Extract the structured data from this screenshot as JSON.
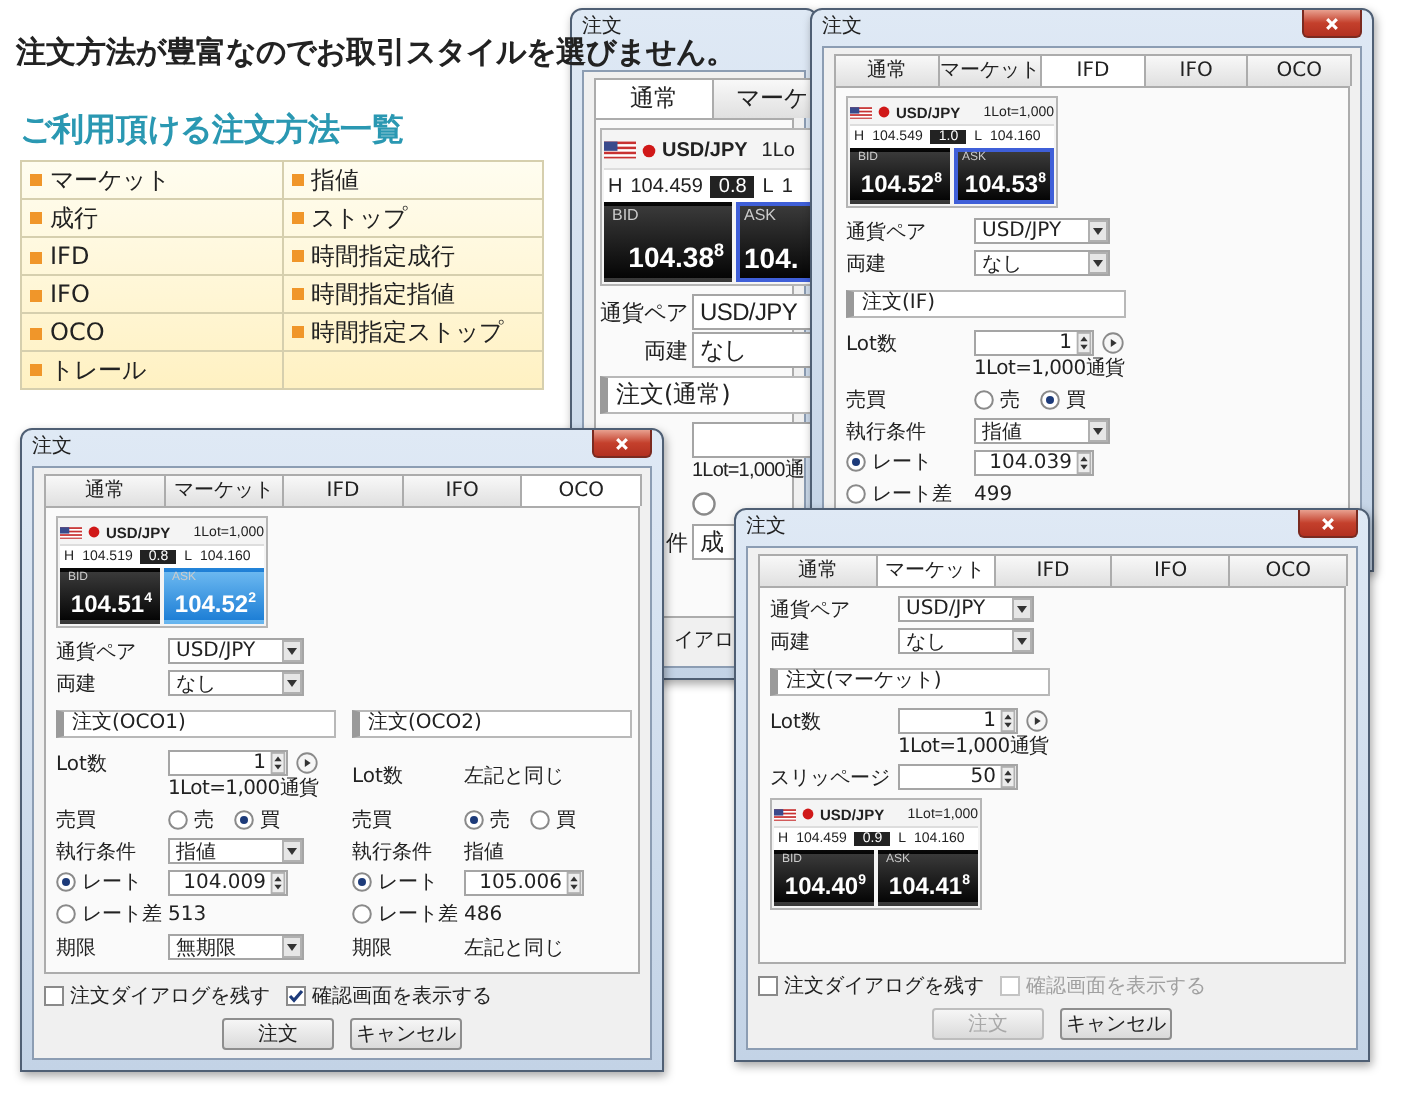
{
  "headline": "注文方法が豊富なのでお取引スタイルを選びません。",
  "subheading": "ご利用頂ける注文方法一覧",
  "order_types": [
    {
      "cells": [
        "マーケット",
        "指値"
      ]
    },
    {
      "cells": [
        "成行",
        "ストップ"
      ]
    },
    {
      "cells": [
        "IFD",
        "時間指定成行"
      ]
    },
    {
      "cells": [
        "IFO",
        "時間指定指値"
      ]
    },
    {
      "cells": [
        "OCO",
        "時間指定ストップ"
      ]
    },
    {
      "cells": [
        "トレール"
      ]
    }
  ],
  "windows": [
    {
      "kind": "zoomed",
      "title": "注文",
      "tabs": [
        {
          "label": "通常",
          "selected": true
        },
        {
          "label": "マーケ",
          "selected": false
        }
      ],
      "blocks": [
        {
          "kind": "quote",
          "pair": "USD/JPY",
          "lot_unit": "1Lo",
          "high_label": "H",
          "high": "104.459",
          "spread": "0.8",
          "low_label": "L",
          "low": "1",
          "bid_label": "BID",
          "bid": "104.38$^{8}$",
          "ask_label": "ASK",
          "ask": "104.",
          "ask_outlined": true,
          "ask_filled": false
        },
        {
          "kind": "select",
          "label": "通貨ペア",
          "value": "USD/JPY"
        },
        {
          "kind": "select",
          "label": "両建",
          "value": "なし"
        },
        {
          "kind": "header",
          "text": "注文(通常)"
        },
        {
          "kind": "spin",
          "note": "1Lot=1,000通"
        },
        {
          "kind": "radios",
          "options": [
            {
              "selected": false
            }
          ]
        },
        {
          "kind": "select",
          "label": "件",
          "value": "成"
        }
      ],
      "checks": [
        {
          "label": "イアロ"
        }
      ]
    },
    {
      "kind": "dialog",
      "title": "注文",
      "tabs": [
        {
          "label": "通常",
          "selected": false
        },
        {
          "label": "マーケット",
          "selected": false
        },
        {
          "label": "IFD",
          "selected": true
        },
        {
          "label": "IFO",
          "selected": false
        },
        {
          "label": "OCO",
          "selected": false
        }
      ],
      "blocks": [
        {
          "kind": "quote",
          "pair": "USD/JPY",
          "lot_unit": "1Lot=1,000",
          "high_label": "H",
          "high": "104.549",
          "spread": "1.0",
          "low_label": "L",
          "low": "104.160",
          "bid_label": "BID",
          "bid": "104.52$^{8}$",
          "ask_label": "ASK",
          "ask": "104.53$^{8}$",
          "ask_outlined": true,
          "ask_filled": false
        },
        {
          "kind": "select",
          "label": "通貨ペア",
          "value": "USD/JPY"
        },
        {
          "kind": "select",
          "label": "両建",
          "value": "なし"
        },
        {
          "kind": "header",
          "text": "注文(IF)"
        },
        {
          "kind": "spin",
          "label": "Lot数",
          "value": "1",
          "play": true,
          "note": "1Lot=1,000通貨"
        },
        {
          "kind": "radios",
          "label": "売買",
          "options": [
            {
              "label": "売",
              "selected": false
            },
            {
              "label": "買",
              "selected": true
            }
          ]
        },
        {
          "kind": "select",
          "label": "執行条件",
          "value": "指値"
        },
        {
          "kind": "radio_spin",
          "label": "レート",
          "selected": true,
          "value": "104.039"
        },
        {
          "kind": "radio_text",
          "label": "レート差",
          "selected": false,
          "value": "499"
        }
      ]
    },
    {
      "kind": "dialog",
      "title": "注文",
      "tabs": [
        {
          "label": "通常",
          "selected": false
        },
        {
          "label": "マーケット",
          "selected": false
        },
        {
          "label": "IFD",
          "selected": false
        },
        {
          "label": "IFO",
          "selected": false
        },
        {
          "label": "OCO",
          "selected": true
        }
      ],
      "blocks": [
        {
          "kind": "quote",
          "pair": "USD/JPY",
          "lot_unit": "1Lot=1,000",
          "high_label": "H",
          "high": "104.519",
          "spread": "0.8",
          "low_label": "L",
          "low": "104.160",
          "bid_label": "BID",
          "bid": "104.51$^{4}$",
          "ask_label": "ASK",
          "ask": "104.52$^{2}$",
          "ask_outlined": false,
          "ask_filled": true
        },
        {
          "kind": "select",
          "label": "通貨ペア",
          "value": "USD/JPY"
        },
        {
          "kind": "select",
          "label": "両建",
          "value": "なし"
        },
        {
          "kind": "columns",
          "columns": [
            [
              {
                "kind": "header",
                "text": "注文(OCO1)"
              },
              {
                "kind": "spin",
                "label": "Lot数",
                "value": "1",
                "play": true,
                "note": "1Lot=1,000通貨"
              },
              {
                "kind": "radios",
                "label": "売買",
                "options": [
                  {
                    "label": "売",
                    "selected": false
                  },
                  {
                    "label": "買",
                    "selected": true
                  }
                ]
              },
              {
                "kind": "select",
                "label": "執行条件",
                "value": "指値"
              },
              {
                "kind": "radio_spin",
                "label": "レート",
                "selected": true,
                "value": "104.009"
              },
              {
                "kind": "radio_text",
                "label": "レート差",
                "selected": false,
                "value": "513"
              },
              {
                "kind": "select",
                "label": "期限",
                "value": "無期限"
              }
            ],
            [
              {
                "kind": "header",
                "text": "注文(OCO2)"
              },
              {
                "kind": "text",
                "label": "Lot数",
                "value": "左記と同じ"
              },
              {
                "kind": "radios",
                "label": "売買",
                "options": [
                  {
                    "label": "売",
                    "selected": true
                  },
                  {
                    "label": "買",
                    "selected": false
                  }
                ]
              },
              {
                "kind": "text",
                "label": "執行条件",
                "value": "指値"
              },
              {
                "kind": "radio_spin",
                "label": "レート",
                "selected": true,
                "value": "105.006"
              },
              {
                "kind": "radio_text",
                "label": "レート差",
                "selected": false,
                "value": "486"
              },
              {
                "kind": "text",
                "label": "期限",
                "value": "左記と同じ"
              }
            ]
          ]
        }
      ],
      "checks": [
        {
          "label": "注文ダイアログを残す",
          "checked": false,
          "disabled": false
        },
        {
          "label": "確認画面を表示する",
          "checked": true,
          "disabled": false
        }
      ],
      "buttons": [
        {
          "label": "注文",
          "disabled": false
        },
        {
          "label": "キャンセル",
          "disabled": false
        }
      ]
    },
    {
      "kind": "dialog",
      "title": "注文",
      "tabs": [
        {
          "label": "通常",
          "selected": false
        },
        {
          "label": "マーケット",
          "selected": true
        },
        {
          "label": "IFD",
          "selected": false
        },
        {
          "label": "IFO",
          "selected": false
        },
        {
          "label": "OCO",
          "selected": false
        }
      ],
      "blocks": [
        {
          "kind": "select",
          "label": "通貨ペア",
          "value": "USD/JPY"
        },
        {
          "kind": "select",
          "label": "両建",
          "value": "なし"
        },
        {
          "kind": "header",
          "text": "注文(マーケット)"
        },
        {
          "kind": "spin",
          "label": "Lot数",
          "value": "1",
          "play": true,
          "note": "1Lot=1,000通貨"
        },
        {
          "kind": "spin",
          "label": "スリッページ",
          "value": "50"
        },
        {
          "kind": "quote",
          "pair": "USD/JPY",
          "lot_unit": "1Lot=1,000",
          "high_label": "H",
          "high": "104.459",
          "spread": "0.9",
          "low_label": "L",
          "low": "104.160",
          "bid_label": "BID",
          "bid": "104.40$^{9}$",
          "ask_label": "ASK",
          "ask": "104.41$^{8}$",
          "ask_outlined": false,
          "ask_filled": false
        }
      ],
      "checks": [
        {
          "label": "注文ダイアログを残す",
          "checked": false,
          "disabled": false
        },
        {
          "label": "確認画面を表示する",
          "checked": false,
          "disabled": true
        }
      ],
      "buttons": [
        {
          "label": "注文",
          "disabled": true
        },
        {
          "label": "キャンセル",
          "disabled": false
        }
      ]
    }
  ]
}
